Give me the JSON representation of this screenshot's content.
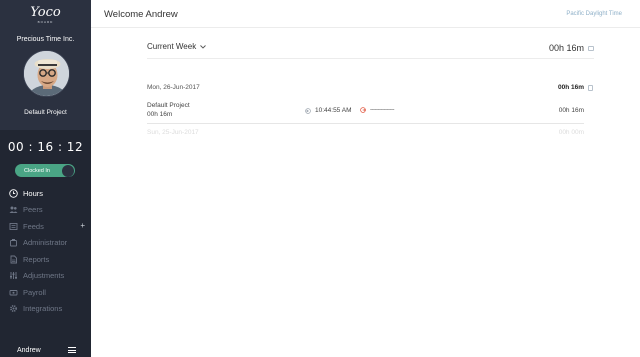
{
  "sidebar": {
    "logo_word": "Yoco",
    "logo_sub": "BOARD",
    "org_name": "Precious Time Inc.",
    "project_name": "Default Project",
    "timer": "00 : 16 : 12",
    "clock_status": "Clocked In",
    "nav": [
      {
        "label": "Hours",
        "icon": "clock-icon",
        "active": true
      },
      {
        "label": "Peers",
        "icon": "people-icon",
        "active": false
      },
      {
        "label": "Feeds",
        "icon": "feed-icon",
        "active": false
      },
      {
        "label": "Administrator",
        "icon": "admin-icon",
        "active": false
      },
      {
        "label": "Reports",
        "icon": "report-icon",
        "active": false
      },
      {
        "label": "Adjustments",
        "icon": "adjust-icon",
        "active": false
      },
      {
        "label": "Payroll",
        "icon": "payroll-icon",
        "active": false
      },
      {
        "label": "Integrations",
        "icon": "gear-icon",
        "active": false
      }
    ],
    "plus": "+",
    "user": "Andrew"
  },
  "header": {
    "welcome": "Welcome Andrew",
    "timezone": "Pacific Daylight Time"
  },
  "week": {
    "label": "Current Week",
    "total": "00h 16m"
  },
  "days": [
    {
      "date": "Mon, 26-Jun-2017",
      "total": "00h 16m",
      "entries": [
        {
          "project": "Default Project",
          "duration": "00h 16m",
          "clock_in": "10:44:55 AM",
          "clock_out": "----------------",
          "total": "00h 16m"
        }
      ]
    },
    {
      "date": "Sun, 25-Jun-2017",
      "total": "00h 00m"
    }
  ],
  "colors": {
    "sidebar": "#2b3140",
    "sidebar_dark": "#212632",
    "accent_green": "#4aa585",
    "timezone_blue": "#8fb0c8",
    "clock_in_icon": "#9aa3ad",
    "clock_out_icon": "#e0533c"
  }
}
